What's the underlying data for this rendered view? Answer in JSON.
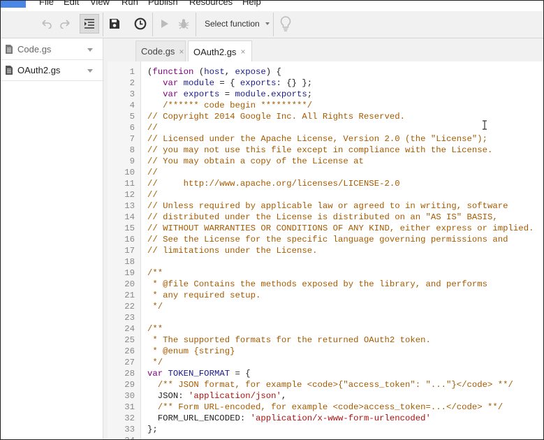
{
  "menu": {
    "items": [
      "File",
      "Edit",
      "View",
      "Run",
      "Publish",
      "Resources",
      "Help"
    ]
  },
  "toolbar": {
    "undo_icon": "undo-icon",
    "redo_icon": "redo-icon",
    "indent_icon": "indent-icon",
    "save_icon": "save-icon",
    "triggers_icon": "clock-icon",
    "run_icon": "play-icon",
    "debug_icon": "bug-icon",
    "function_select": "Select function",
    "tips_icon": "lightbulb-icon"
  },
  "sidebar": {
    "files": [
      {
        "name": "Code.gs"
      },
      {
        "name": "OAuth2.gs"
      }
    ]
  },
  "tabs": [
    {
      "name": "Code.gs",
      "close": "×"
    },
    {
      "name": "OAuth2.gs",
      "close": "×"
    }
  ],
  "editor": {
    "lines": [
      "(function (host, expose) {",
      "   var module = { exports: {} };",
      "   var exports = module.exports;",
      "   /****** code begin *********/",
      "// Copyright 2014 Google Inc. All Rights Reserved.",
      "//",
      "// Licensed under the Apache License, Version 2.0 (the \"License\");",
      "// you may not use this file except in compliance with the License.",
      "// You may obtain a copy of the License at",
      "//",
      "//     http://www.apache.org/licenses/LICENSE-2.0",
      "//",
      "// Unless required by applicable law or agreed to in writing, software",
      "// distributed under the License is distributed on an \"AS IS\" BASIS,",
      "// WITHOUT WARRANTIES OR CONDITIONS OF ANY KIND, either express or implied.",
      "// See the License for the specific language governing permissions and",
      "// limitations under the License.",
      "",
      "/**",
      " * @file Contains the methods exposed by the library, and performs",
      " * any required setup.",
      " */",
      "",
      "/**",
      " * The supported formats for the returned OAuth2 token.",
      " * @enum {string}",
      " */",
      "var TOKEN_FORMAT = {",
      "  /** JSON format, for example <code>{\"access_token\": \"...\"}</code> **/",
      "  JSON: 'application/json',",
      "  /** Form URL-encoded, for example <code>access_token=...</code> **/",
      "  FORM_URL_ENCODED: 'application/x-www-form-urlencoded'",
      "};",
      ""
    ]
  },
  "colors": {
    "comment": "#a55a00",
    "keyword": "#7f0055",
    "identifier": "#1a1a8a",
    "string": "#aa1111",
    "accent": "#4a86e8"
  }
}
